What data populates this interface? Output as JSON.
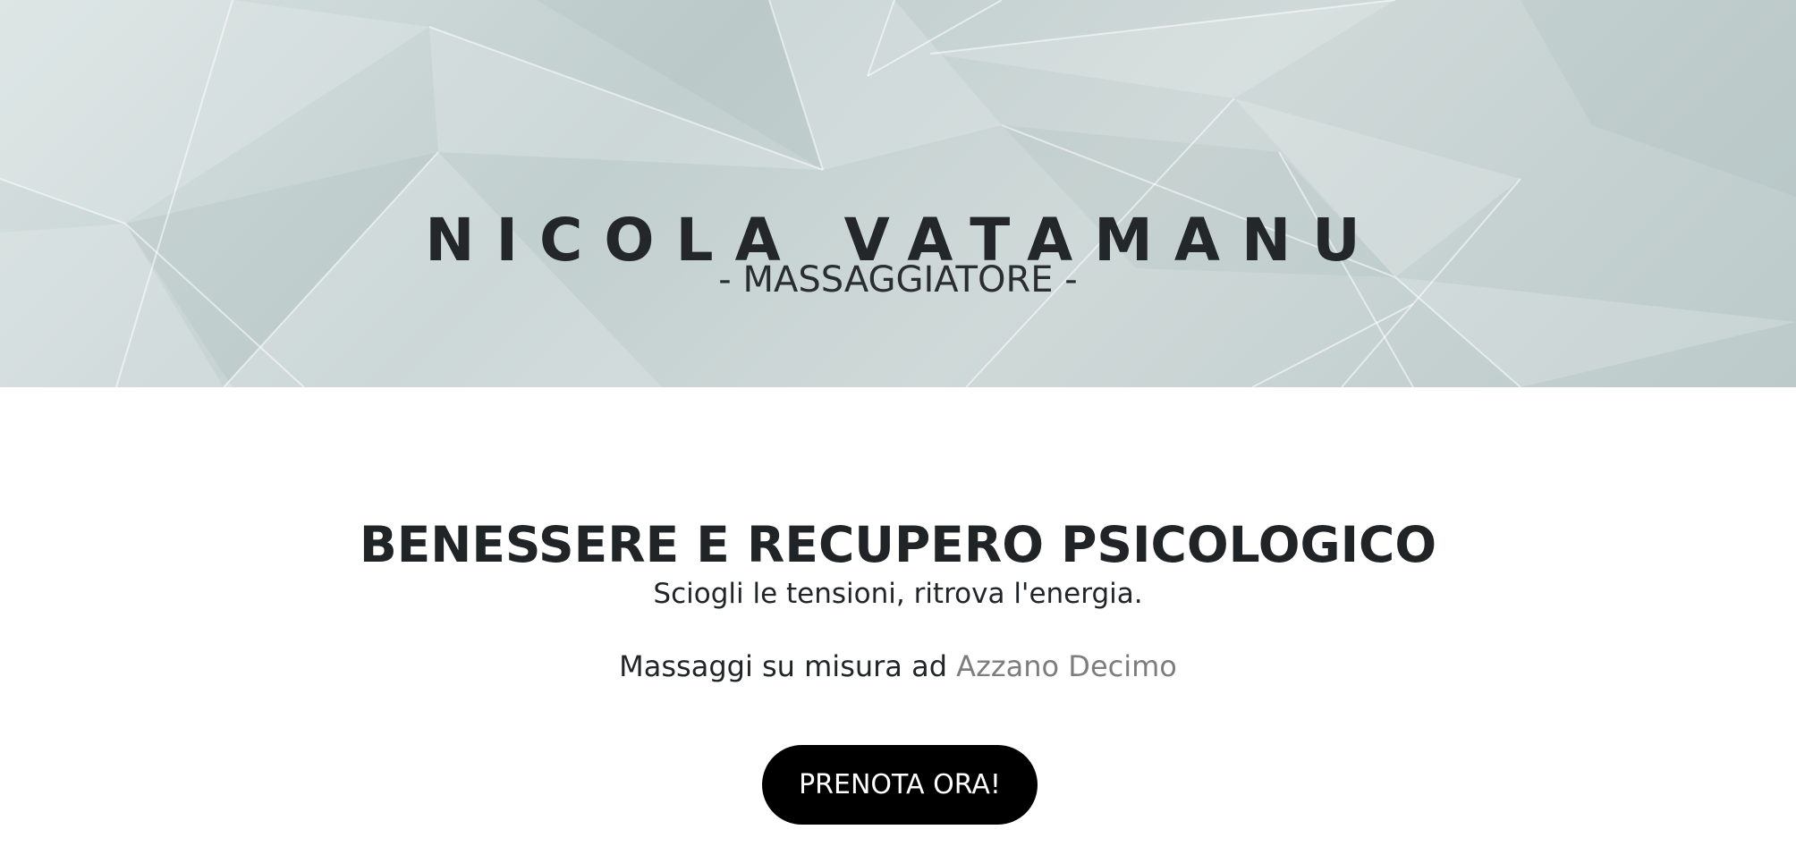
{
  "hero": {
    "name": "NICOLA VATAMANU",
    "role": "- MASSAGGIATORE -"
  },
  "main": {
    "headline": "BENESSERE E RECUPERO PSICOLOGICO",
    "tagline": "Sciogli le tensioni, ritrova l'energia.",
    "location_prefix": "Massaggi su misura ad",
    "location_link": "Azzano Decimo",
    "cta_label": "PRENOTA ORA!"
  },
  "colors": {
    "hero_background": "#c8d3d3",
    "text_dark": "#212427",
    "link_grey": "#7d7d7d",
    "button_bg": "#000000",
    "button_text": "#ffffff"
  }
}
